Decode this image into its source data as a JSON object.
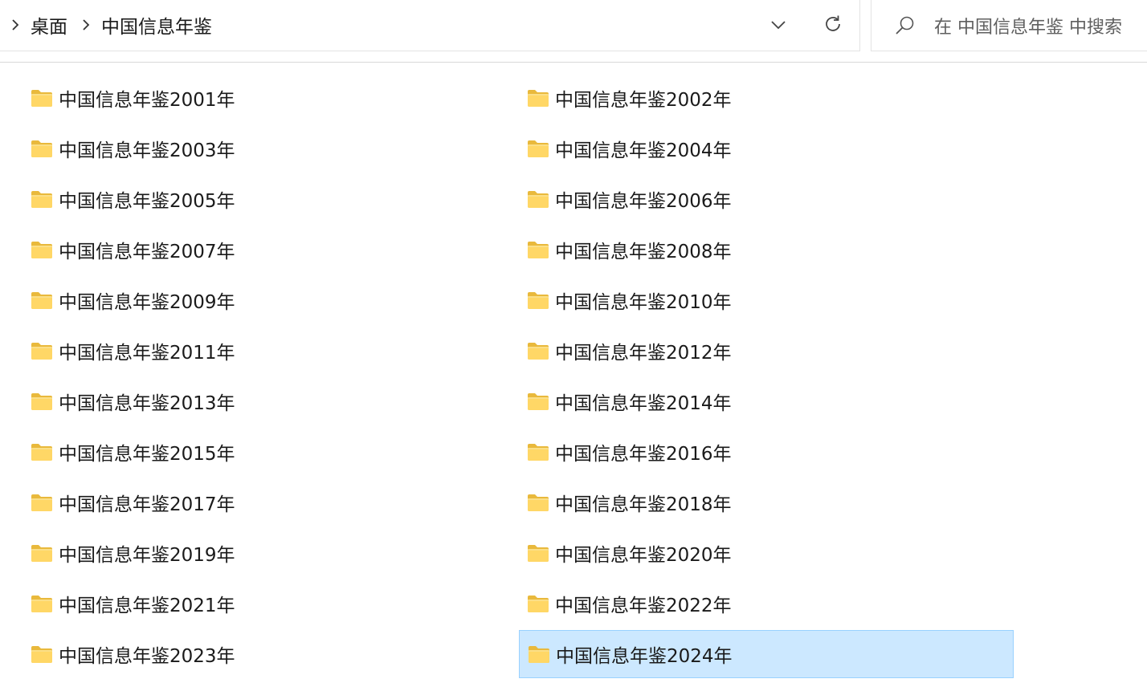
{
  "breadcrumb": {
    "items": [
      "桌面",
      "中国信息年鉴"
    ]
  },
  "search": {
    "placeholder": "在 中国信息年鉴 中搜索"
  },
  "icons": {
    "back_chevron": "chevron-right-icon",
    "separator": "chevron-right-icon",
    "dropdown": "chevron-down-icon",
    "refresh": "refresh-icon",
    "search": "search-icon",
    "folder": "folder-icon"
  },
  "colors": {
    "selection_fill": "#cce8ff",
    "selection_border": "#99d1ff",
    "folder_yellow": "#ffd766"
  },
  "folders": [
    "中国信息年鉴2001年",
    "中国信息年鉴2002年",
    "中国信息年鉴2003年",
    "中国信息年鉴2004年",
    "中国信息年鉴2005年",
    "中国信息年鉴2006年",
    "中国信息年鉴2007年",
    "中国信息年鉴2008年",
    "中国信息年鉴2009年",
    "中国信息年鉴2010年",
    "中国信息年鉴2011年",
    "中国信息年鉴2012年",
    "中国信息年鉴2013年",
    "中国信息年鉴2014年",
    "中国信息年鉴2015年",
    "中国信息年鉴2016年",
    "中国信息年鉴2017年",
    "中国信息年鉴2018年",
    "中国信息年鉴2019年",
    "中国信息年鉴2020年",
    "中国信息年鉴2021年",
    "中国信息年鉴2022年",
    "中国信息年鉴2023年",
    "中国信息年鉴2024年"
  ],
  "selected_folder": "中国信息年鉴2024年"
}
